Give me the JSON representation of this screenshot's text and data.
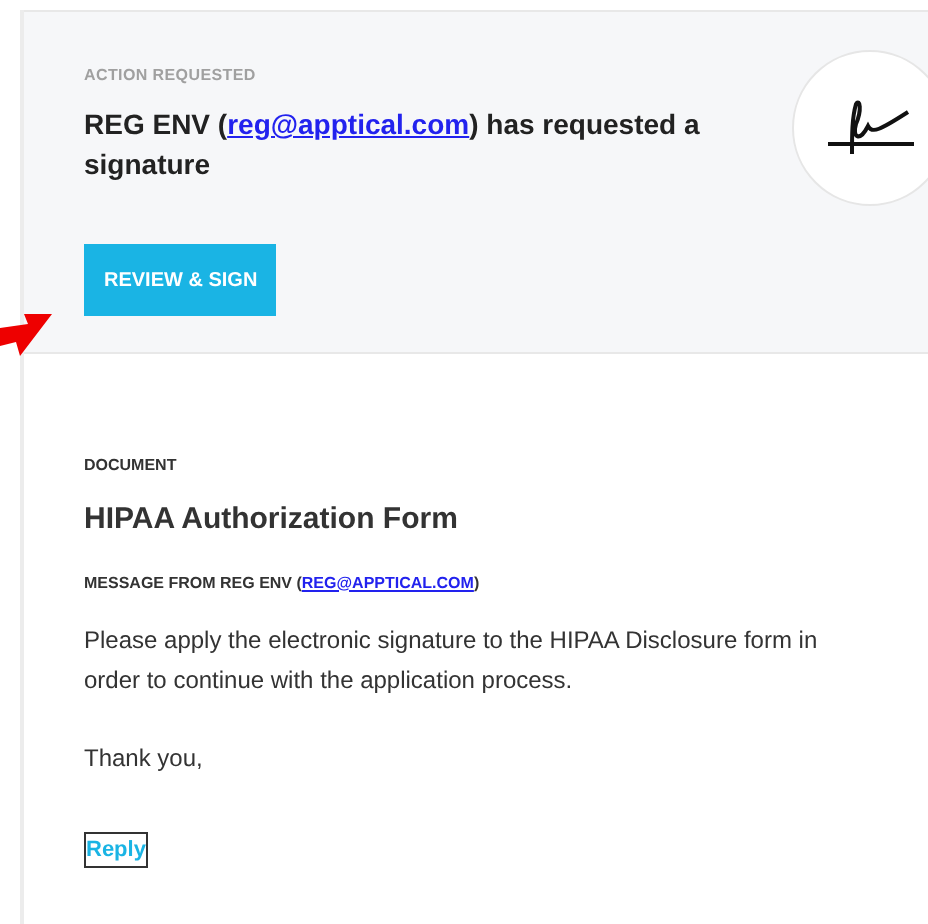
{
  "header": {
    "label": "ACTION REQUESTED",
    "request": {
      "before": "REG ENV (",
      "link": "reg@apptical.com",
      "after": ") has requested a signature"
    },
    "button": "REVIEW & SIGN"
  },
  "document": {
    "label": "DOCUMENT",
    "title": "HIPAA Authorization Form",
    "message_from": {
      "before": "MESSAGE FROM REG ENV (",
      "link": "REG@APPTICAL.COM",
      "after": ")"
    },
    "message": "Please apply the electronic signature to the HIPAA Disclosure form in order to continue with the application process.",
    "closing": "Thank you,",
    "reply": "Reply"
  }
}
